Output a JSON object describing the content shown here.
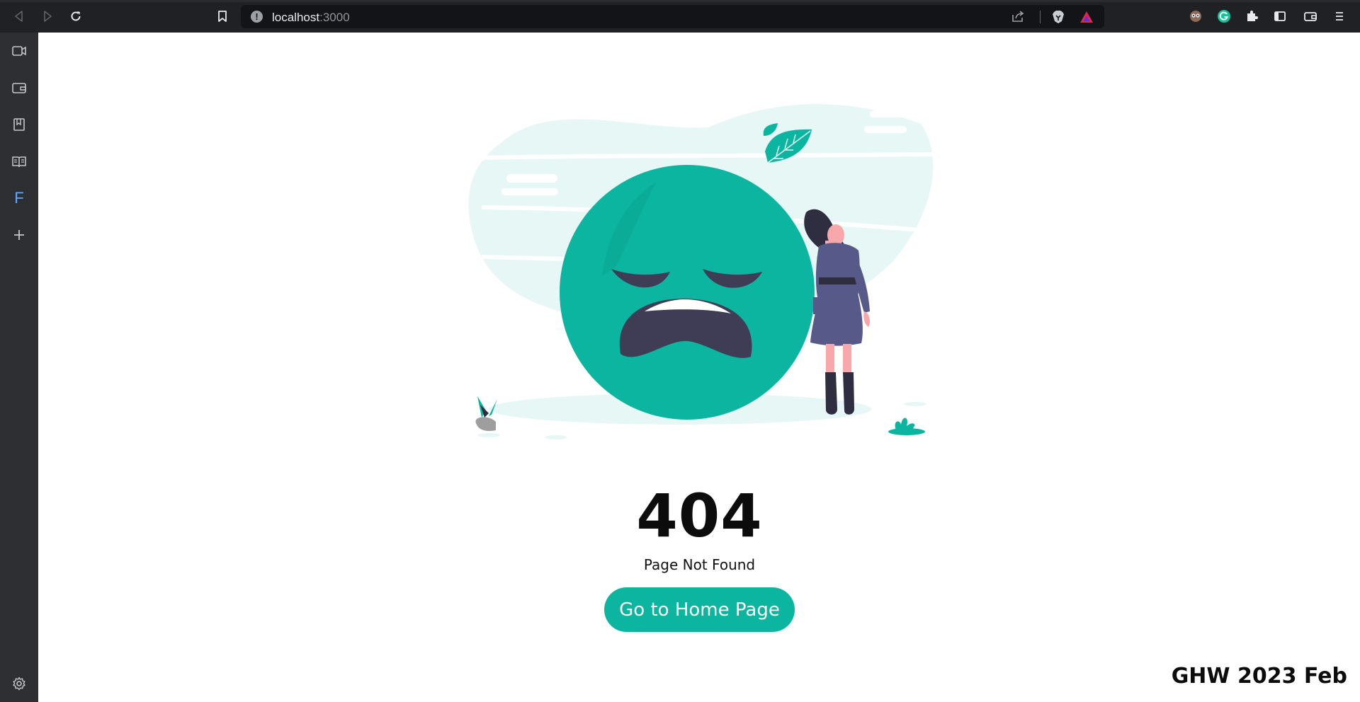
{
  "browser": {
    "url_host": "localhost",
    "url_port": ":3000",
    "back_label": "Back",
    "forward_label": "Forward",
    "reload_label": "Reload"
  },
  "sidebar": {
    "items": [
      {
        "icon": "video-call-icon"
      },
      {
        "icon": "wallet-icon"
      },
      {
        "icon": "bookmarks-icon"
      },
      {
        "icon": "reading-list-icon"
      },
      {
        "icon": "f-letter-icon",
        "letter": "F"
      },
      {
        "icon": "plus-icon"
      }
    ],
    "settings_icon": "gear-icon"
  },
  "page": {
    "code": "404",
    "message": "Page Not Found",
    "button_label": "Go to Home Page",
    "watermark": "GHW 2023 Feb"
  },
  "colors": {
    "accent": "#0bb5a0",
    "toolbar": "#202124",
    "sidebar": "#2e2f33",
    "blob": "#e6f7f5",
    "face_features": "#3f3d56",
    "dress": "#575a89"
  }
}
